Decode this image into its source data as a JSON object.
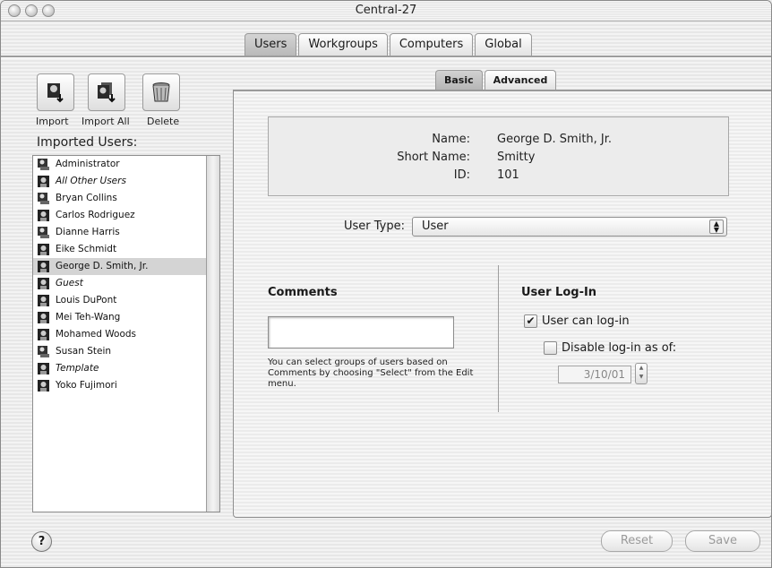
{
  "window": {
    "title": "Central-27"
  },
  "top_tabs": [
    "Users",
    "Workgroups",
    "Computers",
    "Global"
  ],
  "toolbar": {
    "import_label": "Import",
    "import_all_label": "Import All",
    "delete_label": "Delete"
  },
  "imported_users_label": "Imported Users:",
  "users": [
    {
      "name": "Administrator",
      "italic": false,
      "icon": "admin-user-icon"
    },
    {
      "name": "All Other Users",
      "italic": true,
      "icon": "user-icon"
    },
    {
      "name": "Bryan Collins",
      "italic": false,
      "icon": "admin-user-icon"
    },
    {
      "name": "Carlos Rodriguez",
      "italic": false,
      "icon": "user-icon"
    },
    {
      "name": "Dianne Harris",
      "italic": false,
      "icon": "admin-user-icon"
    },
    {
      "name": "Eike Schmidt",
      "italic": false,
      "icon": "user-icon"
    },
    {
      "name": "George D. Smith, Jr.",
      "italic": false,
      "icon": "user-icon",
      "selected": true
    },
    {
      "name": "Guest",
      "italic": true,
      "icon": "user-icon"
    },
    {
      "name": "Louis DuPont",
      "italic": false,
      "icon": "user-icon"
    },
    {
      "name": "Mei Teh-Wang",
      "italic": false,
      "icon": "user-icon"
    },
    {
      "name": "Mohamed Woods",
      "italic": false,
      "icon": "user-icon"
    },
    {
      "name": "Susan Stein",
      "italic": false,
      "icon": "admin-user-icon"
    },
    {
      "name": "Template",
      "italic": true,
      "icon": "user-icon"
    },
    {
      "name": "Yoko Fujimori",
      "italic": false,
      "icon": "user-icon"
    }
  ],
  "sub_tabs": [
    "Basic",
    "Advanced"
  ],
  "info": {
    "name_label": "Name:",
    "name_value": "George D. Smith, Jr.",
    "short_name_label": "Short Name:",
    "short_name_value": "Smitty",
    "id_label": "ID:",
    "id_value": "101"
  },
  "user_type": {
    "label": "User Type:",
    "value": "User"
  },
  "comments": {
    "heading": "Comments",
    "value": "",
    "help": "You can select groups of users based on Comments by choosing \"Select\" from the Edit menu."
  },
  "login": {
    "heading": "User Log-In",
    "can_login_label": "User can log-in",
    "can_login_checked": true,
    "disable_label": "Disable log-in as of:",
    "disable_checked": false,
    "date": "3/10/01"
  },
  "footer": {
    "help": "?",
    "reset_label": "Reset",
    "save_label": "Save"
  }
}
